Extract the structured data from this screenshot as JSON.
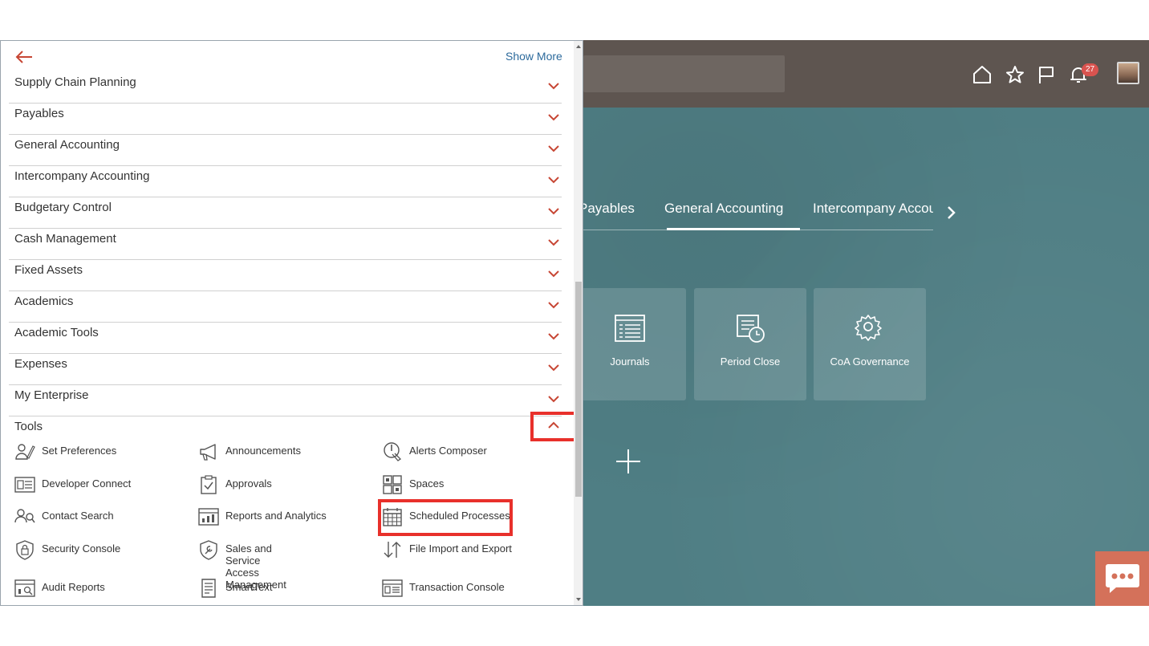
{
  "panel": {
    "show_more": "Show More",
    "categories": [
      {
        "label": "Supply Chain Planning"
      },
      {
        "label": "Payables"
      },
      {
        "label": "General Accounting"
      },
      {
        "label": "Intercompany Accounting"
      },
      {
        "label": "Budgetary Control"
      },
      {
        "label": "Cash Management"
      },
      {
        "label": "Fixed Assets"
      },
      {
        "label": "Academics"
      },
      {
        "label": "Academic Tools"
      },
      {
        "label": "Expenses"
      },
      {
        "label": "My Enterprise"
      }
    ],
    "tools_label": "Tools",
    "tools": [
      {
        "label": "Set Preferences",
        "icon": "set-preferences-icon"
      },
      {
        "label": "Announcements",
        "icon": "megaphone-icon"
      },
      {
        "label": "Alerts Composer",
        "icon": "alerts-composer-icon"
      },
      {
        "label": "Developer Connect",
        "icon": "developer-connect-icon"
      },
      {
        "label": "Approvals",
        "icon": "clipboard-check-icon"
      },
      {
        "label": "Spaces",
        "icon": "spaces-icon"
      },
      {
        "label": "Contact Search",
        "icon": "contact-search-icon"
      },
      {
        "label": "Reports and Analytics",
        "icon": "reports-icon"
      },
      {
        "label": "Scheduled Processes",
        "icon": "calendar-icon"
      },
      {
        "label": "Security Console",
        "icon": "shield-icon"
      },
      {
        "label": "Sales and Service Access\nManagement",
        "icon": "shield-wrench-icon"
      },
      {
        "label": "File Import and Export",
        "icon": "import-export-icon"
      },
      {
        "label": "Audit Reports",
        "icon": "audit-reports-icon"
      },
      {
        "label": "SmartText",
        "icon": "smarttext-icon"
      },
      {
        "label": "Transaction Console",
        "icon": "transaction-console-icon"
      }
    ]
  },
  "app": {
    "notification_count": "27",
    "tabs": [
      "Payables",
      "General Accounting",
      "Intercompany Accour"
    ],
    "active_tab": "General Accounting",
    "tiles": [
      {
        "label": "Journals",
        "icon": "journals-icon"
      },
      {
        "label": "Period Close",
        "icon": "period-close-icon"
      },
      {
        "label": "CoA Governance",
        "icon": "gear-icon"
      }
    ]
  },
  "colors": {
    "highlight": "#e8302b",
    "chevron": "#c74634",
    "link": "#2c6a9c",
    "app_background": "#4f7e84",
    "header_background": "#5e5550",
    "chat_button": "#d4715a"
  }
}
